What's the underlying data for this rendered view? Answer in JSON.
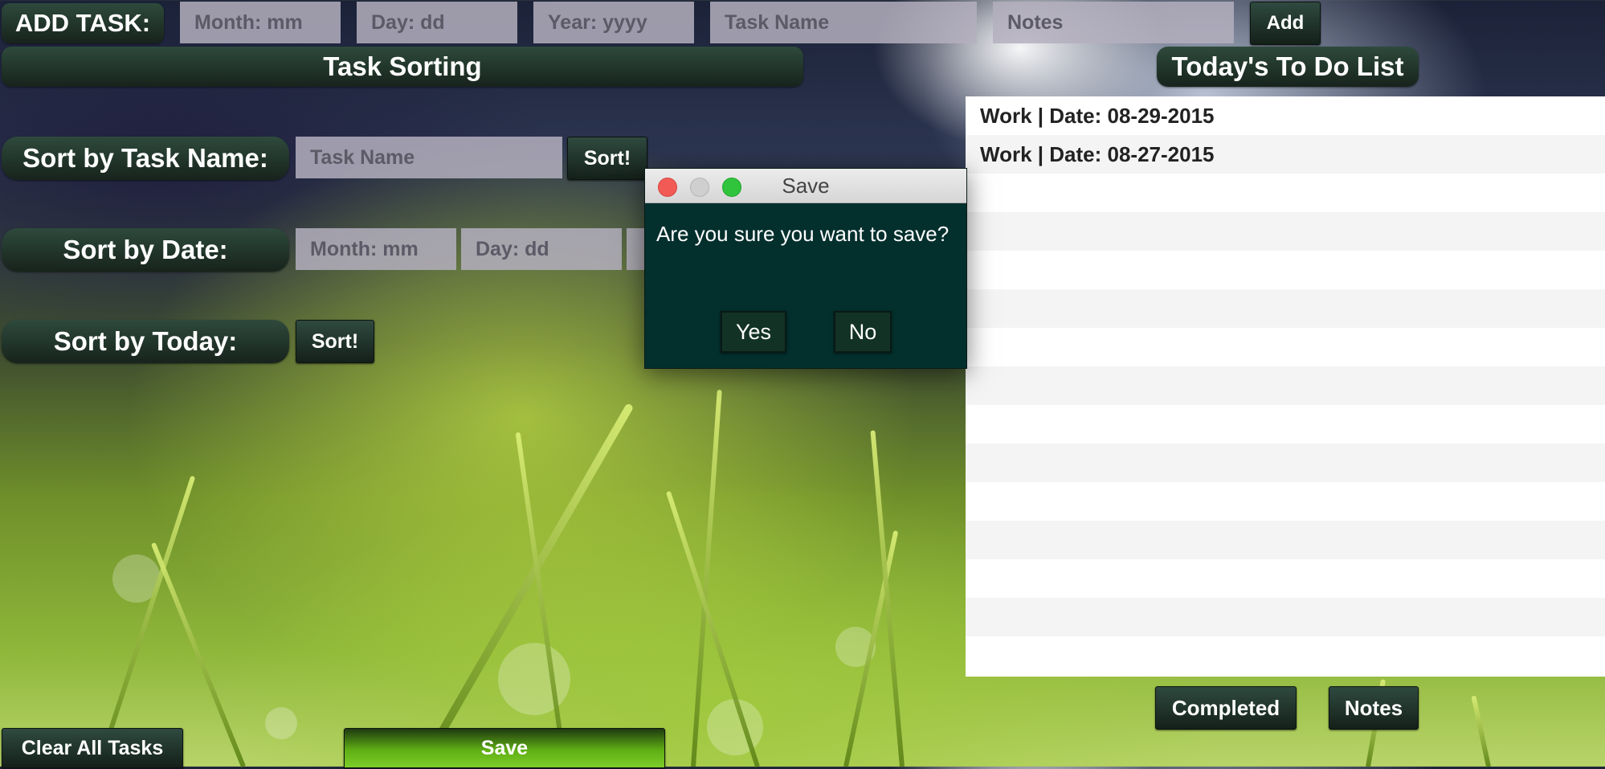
{
  "add_task": {
    "label": "ADD TASK:",
    "month_placeholder": "Month: mm",
    "day_placeholder": "Day: dd",
    "year_placeholder": "Year: yyyy",
    "task_name_placeholder": "Task Name",
    "notes_placeholder": "Notes",
    "add_label": "Add"
  },
  "sorting": {
    "header": "Task Sorting",
    "by_name_label": "Sort by Task Name:",
    "task_name_placeholder": "Task Name",
    "by_name_button": "Sort!",
    "by_date_label": "Sort by Date:",
    "month_placeholder": "Month: mm",
    "day_placeholder": "Day: dd",
    "by_today_label": "Sort by Today:",
    "by_today_button": "Sort!"
  },
  "todo": {
    "header": "Today's To Do List",
    "items": [
      "Work | Date: 08-29-2015",
      "Work | Date: 08-27-2015"
    ],
    "completed_label": "Completed",
    "notes_label": "Notes"
  },
  "footer": {
    "clear_label": "Clear All Tasks",
    "save_label": "Save"
  },
  "dialog": {
    "title": "Save",
    "message": "Are you sure you want to save?",
    "yes_label": "Yes",
    "no_label": "No"
  }
}
